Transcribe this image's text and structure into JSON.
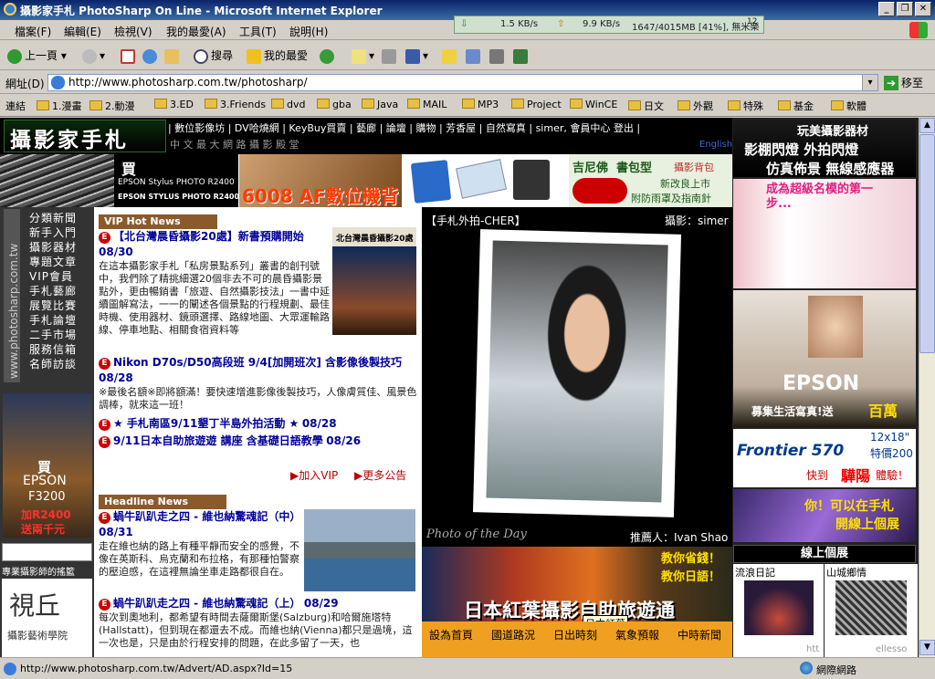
{
  "window": {
    "title": "攝影家手札 PhotoSharp On Line - Microsoft Internet Explorer",
    "net": {
      "down": "1.5 KB/s",
      "up": "9.9 KB/s",
      "mem": "1647/4015MB [41%], 無米樂",
      "counter": "12"
    }
  },
  "menu": [
    "檔案(F)",
    "編輯(E)",
    "檢視(V)",
    "我的最愛(A)",
    "工具(T)",
    "說明(H)"
  ],
  "toolbar": {
    "back": "上一頁",
    "search": "搜尋",
    "favorites": "我的最愛"
  },
  "address": {
    "label": "網址(D)",
    "url": "http://www.photosharp.com.tw/photosharp/",
    "go": "移至"
  },
  "links": {
    "label": "連結",
    "items": [
      "1.漫畫",
      "2.動漫",
      "3.ED",
      "3.Friends",
      "dvd",
      "gba",
      "Java",
      "MAIL",
      "MP3",
      "Project",
      "WinCE",
      "日文",
      "外觀",
      "特殊",
      "基金",
      "軟體"
    ]
  },
  "site": {
    "logo": "攝影家手札",
    "topnav": "| 數位影像坊 | DV哈燒網 | KeyBuy買賣 | 藝廊 | 論壇 | 購物 | 芳香屋 | 自然寫真 | simer, 會員中心 登出 |",
    "tagline": "中 文 最 大 網 路 攝 影 殿 堂",
    "english": "English",
    "url_vertical": "www.photosharp.com.tw",
    "side_menu": [
      "分類新聞",
      "新手入門",
      "攝影器材",
      "專題文章",
      "VIP會員",
      "手札藝廊",
      "展覽比賽",
      "手札論壇",
      "二手市場",
      "服務信箱",
      "名師訪談"
    ],
    "epson_ad": {
      "buy": "買",
      "model": "EPSON Stylus PHOTO R2400",
      "sub": "EPSON STYLUS PHOTO R2400"
    },
    "cam_ad": "6008 AF數位機背",
    "ginfo_ad": {
      "a": "吉尼佛",
      "b": "書包型",
      "c": "攝影背包",
      "d": "新改良上市",
      "e": "附防雨罩及指南針"
    },
    "f3200_ad": {
      "buy": "買",
      "brand": "EPSON",
      "model": "F3200",
      "plus": "加R2400",
      "gift": "送兩千元"
    },
    "school": {
      "caption": "專業攝影師的搖籃",
      "name": "視丘",
      "sub": "攝影藝術學院"
    },
    "vip": {
      "header": "VIP Hot News",
      "items": [
        {
          "title": "【北台灣晨昏攝影20處】新書預購開始",
          "date": "08/30",
          "body": "在這本攝影家手札「私房景點系列」叢書的創刊號中，我們除了精挑細選20個非去不可的晨昏攝影景點外，更由暢銷書「旅遊、自然攝影技法」一書中延續圖解寫法，一一的闡述各個景點的行程規劃、最佳時機、使用器材、鏡頭選擇、路線地圖、大眾運輸路線、停車地點、相關食宿資料等"
        },
        {
          "title": "Nikon D70s/D50高段班 9/4[加開班次] 含影像後製技巧",
          "date": "08/28",
          "body": "※最後名額※即將額滿！要快速增進影像後製技巧，人像膚質佳、風景色調棒，就來這一班！"
        },
        {
          "title": "★ 手札南區9/11墾丁半島外拍活動 ★",
          "date": "08/28",
          "body": ""
        },
        {
          "title": "9/11日本自助旅遊遊 講座 含基礎日語教學",
          "date": "08/26",
          "body": ""
        }
      ],
      "join": "加入VIP",
      "more": "更多公告",
      "book": "北台灣晨昏攝影20處"
    },
    "headline": {
      "header": "Headline News",
      "items": [
        {
          "title": "蝸牛趴趴走之四 - 維也納驚魂記（中）",
          "date": "08/31",
          "body": "走在維也納的路上有種平靜而安全的感覺，不像在英斯科、烏克蘭和布拉格，有那種怕警察的壓迫感，在這裡無論坐車走路都很自在。"
        },
        {
          "title": "蝸牛趴趴走之四 - 維也納驚魂記（上）",
          "date": "08/29",
          "body": "每次到奧地利，都希望有時間去薩爾斯堡(Salzburg)和哈爾施塔特(Hallstatt)，但到現在都還去不成。而維也納(Vienna)都只是過境，這一次也是，只是由於行程安排的問題，在此多留了一天，也"
        }
      ]
    },
    "feature": {
      "label": "【手札外拍-CHER】",
      "photographer": "攝影：simer",
      "potd": "Photo of the Day",
      "recommender": "推薦人：Ivan Shao"
    },
    "japan": {
      "title": "日本紅葉攝影自助旅遊通",
      "slogan1": "教你省錢！",
      "slogan2": "教你日語！",
      "tooltip": "日本紅葉",
      "nav": [
        "設為首頁",
        "國道路況",
        "日出時刻",
        "氣象預報",
        "中時新聞"
      ]
    },
    "right": {
      "ad1": {
        "a": "玩美攝影器材",
        "b": "影棚閃燈 外拍閃燈",
        "c": "仿真佈景 無線感應器"
      },
      "ad2": "成為超級名模的第一步...",
      "epson": {
        "brand": "EPSON",
        "text": "募集生活寫真!送",
        "big": "百萬"
      },
      "frontier": {
        "brand": "Frontier 570",
        "size": "12x18\"",
        "price": "特價200",
        "cta": "快到",
        "store": "驊陽",
        "tail": "體驗！"
      },
      "gallery_ad": {
        "a": "你！可以在手札",
        "b": "開線上個展"
      },
      "gallery_header": "線上個展",
      "galleries": [
        "流浪日記",
        "山城鄉情"
      ],
      "scraps": [
        "htt",
        "ellesso"
      ]
    }
  },
  "status": {
    "url": "http://www.photosharp.com.tw/Advert/AD.aspx?Id=15",
    "zone": "網際網路"
  }
}
